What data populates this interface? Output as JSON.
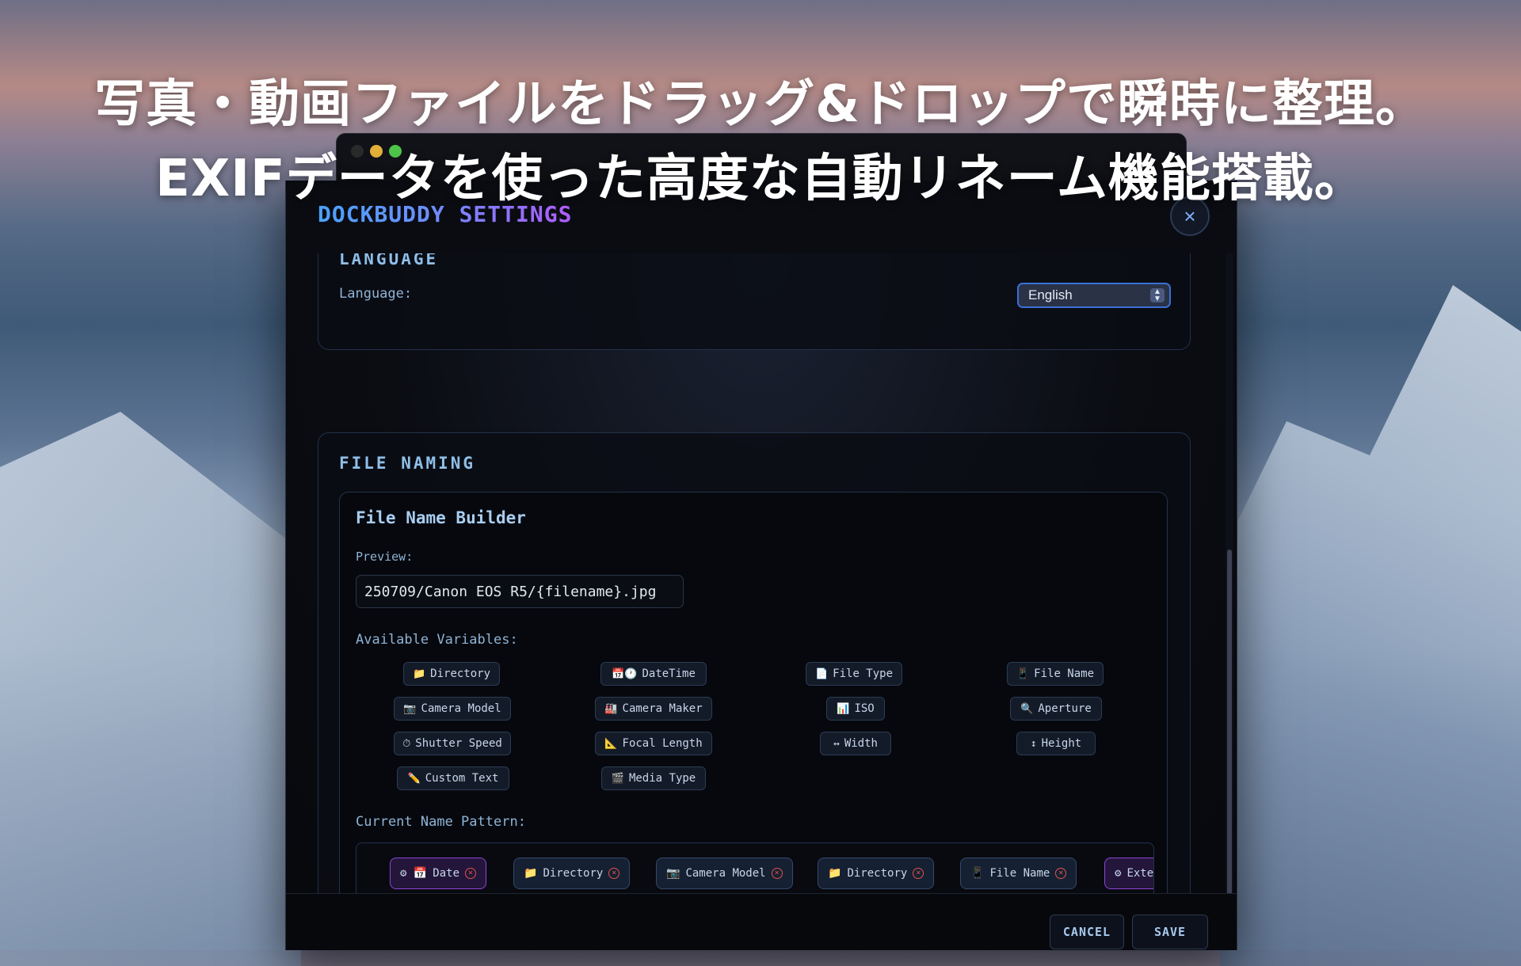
{
  "headline": {
    "line1": "写真・動画ファイルをドラッグ&ドロップで瞬時に整理。",
    "line2": "EXIFデータを使った高度な自動リネーム機能搭載。"
  },
  "dialog": {
    "title": "DOCKBUDDY SETTINGS",
    "close_icon": "×"
  },
  "language_section": {
    "title": "LANGUAGE",
    "label": "Language:",
    "selected": "English"
  },
  "naming_section": {
    "title": "FILE NAMING",
    "builder_title": "File Name Builder",
    "preview_label": "Preview:",
    "preview_value": "250709/Canon EOS R5/{filename}.jpg",
    "variables_label": "Available Variables:",
    "variables": [
      {
        "icon": "📁",
        "label": "Directory"
      },
      {
        "icon": "📅🕐",
        "label": "DateTime"
      },
      {
        "icon": "📄",
        "label": "File Type"
      },
      {
        "icon": "📱",
        "label": "File Name"
      },
      {
        "icon": "📷",
        "label": "Camera Model"
      },
      {
        "icon": "🏭",
        "label": "Camera Maker"
      },
      {
        "icon": "📊",
        "label": "ISO"
      },
      {
        "icon": "🔍",
        "label": "Aperture"
      },
      {
        "icon": "⏱",
        "label": "Shutter Speed"
      },
      {
        "icon": "📐",
        "label": "Focal Length"
      },
      {
        "icon": "↔",
        "label": "Width"
      },
      {
        "icon": "↕",
        "label": "Height"
      },
      {
        "icon": "✏️",
        "label": "Custom Text"
      },
      {
        "icon": "🎬",
        "label": "Media Type"
      }
    ],
    "pattern_label": "Current Name Pattern:",
    "pattern": [
      {
        "icon": "⚙ 📅",
        "label": "Date"
      },
      {
        "icon": "📁",
        "label": "Directory"
      },
      {
        "icon": "📷",
        "label": "Camera Model"
      },
      {
        "icon": "📁",
        "label": "Directory"
      },
      {
        "icon": "📱",
        "label": "File Name"
      },
      {
        "icon": "⚙",
        "label": "Exte"
      }
    ]
  },
  "footer": {
    "cancel_label": "CANCEL",
    "save_label": "SAVE"
  },
  "colors": {
    "accent_blue": "#4aa3ff",
    "accent_purple": "#b05cff",
    "remove_red": "#e0524a"
  }
}
